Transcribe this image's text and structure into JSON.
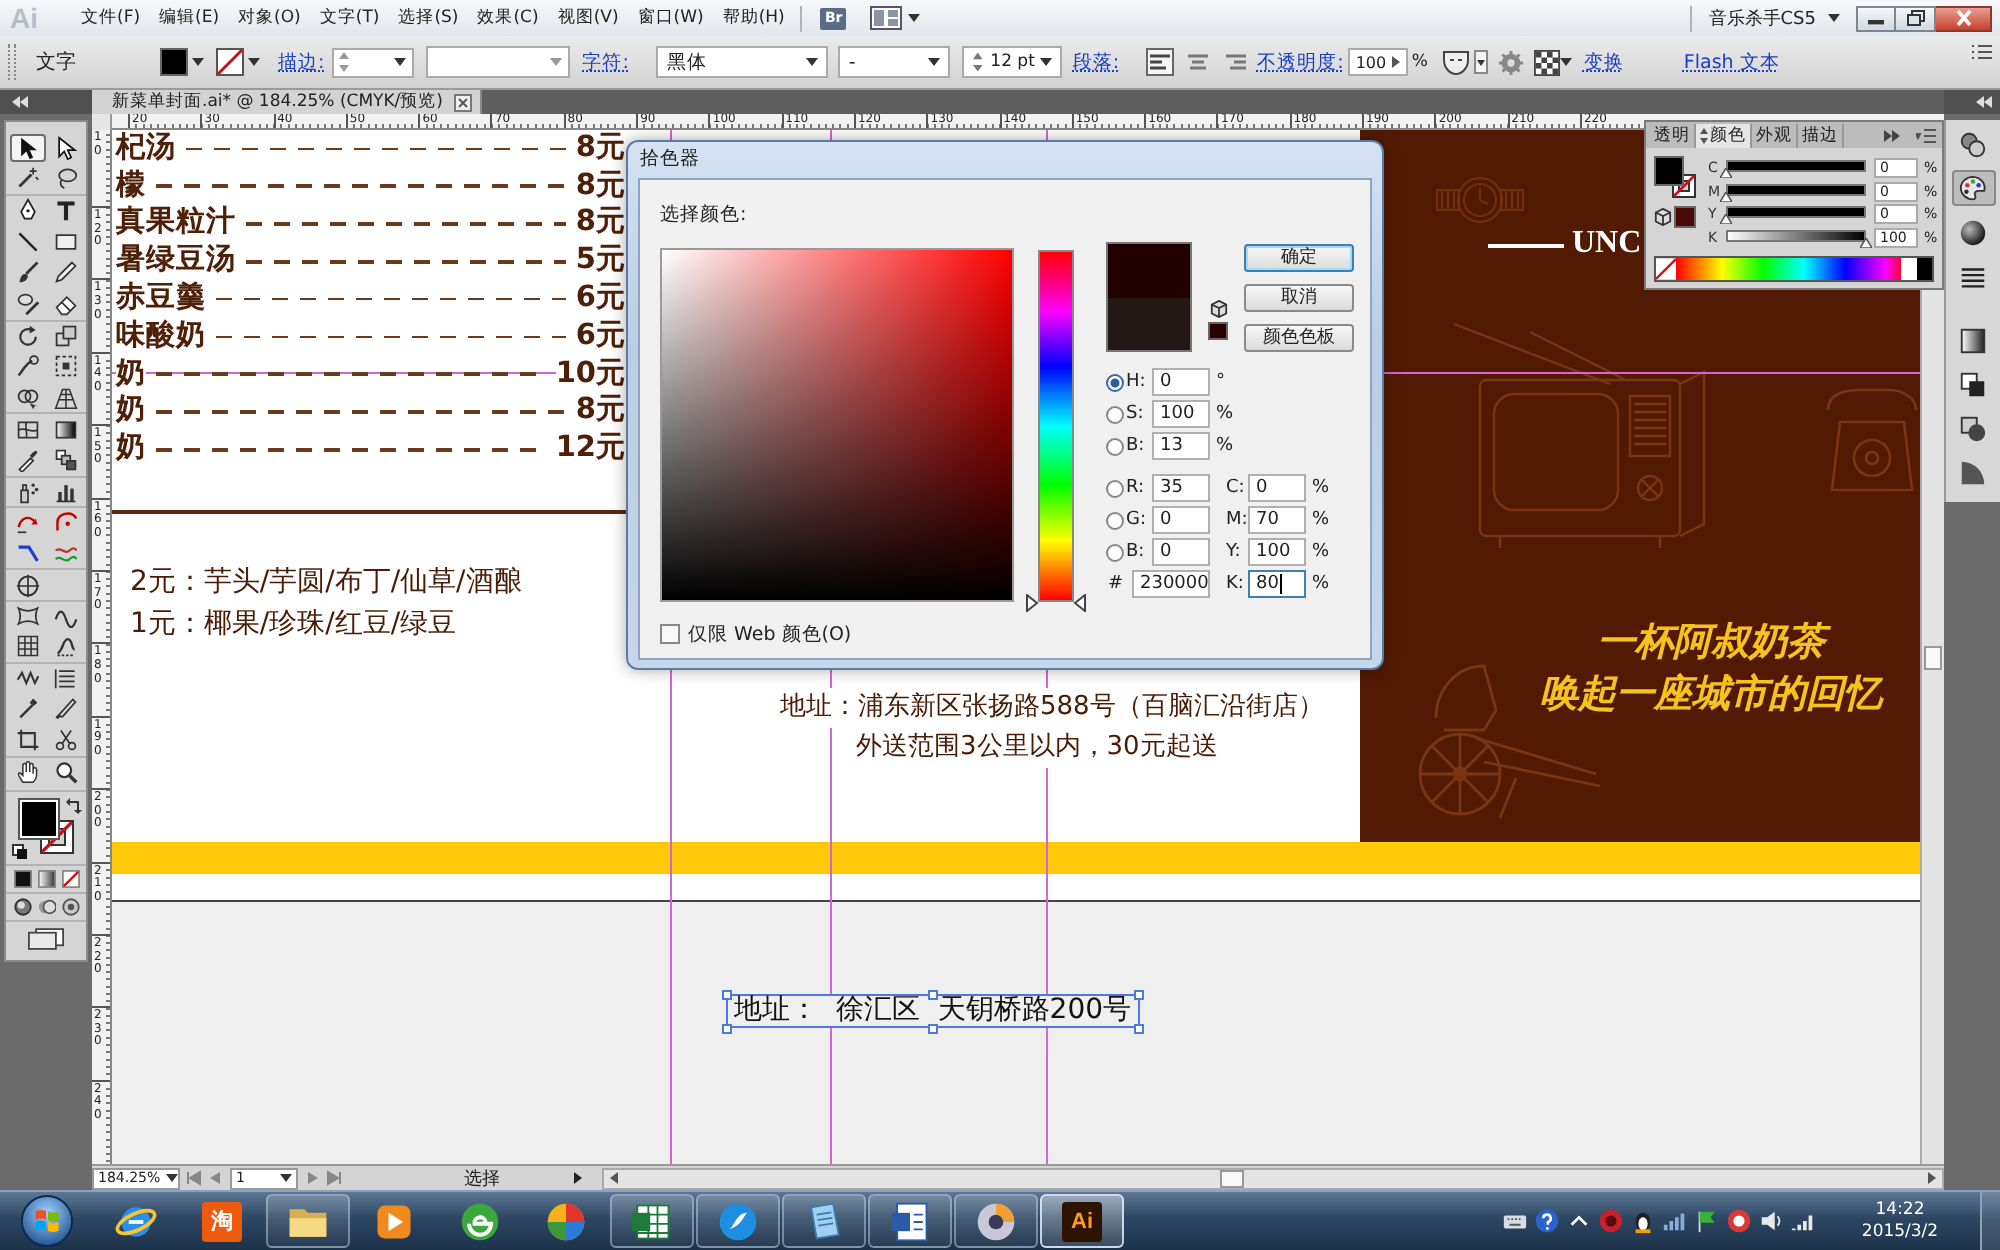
{
  "menu_bar": {
    "logo": "Ai",
    "items": [
      "文件(F)",
      "编辑(E)",
      "对象(O)",
      "文字(T)",
      "选择(S)",
      "效果(C)",
      "视图(V)",
      "窗口(W)",
      "帮助(H)"
    ],
    "bridge": "Br",
    "workspace": "音乐杀手CS5"
  },
  "control_bar": {
    "tool": "文字",
    "stroke_label": "描边:",
    "character_label": "字符:",
    "font": "黑体",
    "font_style": "-",
    "font_size": "12 pt",
    "paragraph_label": "段落:",
    "alignment": [
      {
        "selected": true
      },
      {
        "selected": false
      },
      {
        "selected": false
      }
    ],
    "opacity_label": "不透明度:",
    "opacity": "100",
    "opacity_unit": "%",
    "transform_link": "变换",
    "flash_text_link": "Flash 文本"
  },
  "document_tab": {
    "title": "新菜单封面.ai* @ 184.25% (CMYK/预览)"
  },
  "toolbox": {
    "tools": [
      {
        "selected": true
      },
      {
        "selected": false
      },
      {
        "selected": false
      },
      {
        "selected": false
      },
      {
        "selected": false
      },
      {
        "selected": false
      },
      {
        "selected": false
      },
      {
        "selected": false
      },
      {
        "selected": false
      },
      {
        "selected": false
      },
      {
        "selected": false
      },
      {
        "selected": false
      },
      {
        "selected": false
      },
      {
        "selected": false
      },
      {
        "selected": false
      },
      {
        "selected": false
      },
      {
        "selected": false
      },
      {
        "selected": false
      },
      {
        "selected": false
      },
      {
        "selected": false
      },
      {
        "selected": false
      },
      {
        "selected": false
      },
      {
        "selected": false
      },
      {
        "selected": false
      },
      {
        "selected": false
      },
      {
        "selected": false
      },
      {
        "selected": false
      },
      {
        "selected": false
      },
      {
        "selected": false
      },
      {
        "selected": false
      },
      {
        "selected": false
      },
      {
        "selected": false
      },
      {
        "selected": false
      },
      {
        "selected": false
      },
      {
        "selected": false
      },
      {
        "selected": false
      },
      {
        "selected": false
      },
      {
        "selected": false
      },
      {
        "selected": false
      },
      {
        "selected": false
      },
      {
        "selected": false
      }
    ]
  },
  "rulers": {
    "horizontal": [
      "20",
      "30",
      "40",
      "50",
      "60",
      "70",
      "80",
      "90",
      "100",
      "110",
      "120",
      "130",
      "140",
      "150",
      "160",
      "170",
      "180",
      "190",
      "200",
      "210",
      "220"
    ],
    "vertical": [
      "10",
      "120",
      "130",
      "140",
      "150",
      "160",
      "170",
      "180",
      "190",
      "200",
      "210",
      "220",
      "230",
      "240"
    ]
  },
  "artboard": {
    "menu_items": [
      {
        "name": "杞汤",
        "price": "8元"
      },
      {
        "name": "檬",
        "price": "8元"
      },
      {
        "name": "真果粒汁",
        "price": "8元"
      },
      {
        "name": "暑绿豆汤",
        "price": "5元"
      },
      {
        "name": "赤豆羹",
        "price": "6元"
      },
      {
        "name": "味酸奶",
        "price": "6元"
      },
      {
        "name": "奶",
        "price": "10元"
      },
      {
        "name": "奶",
        "price": "8元"
      },
      {
        "name": "奶",
        "price": "12元"
      }
    ],
    "toppings": [
      "2元：芋头/芋圆/布丁/仙草/酒酿",
      "1元：椰果/珍珠/红豆/绿豆"
    ],
    "address": [
      "地址：浦东新区张扬路588号（百脑汇沿街店）",
      "外送范围3公里以内，30元起送"
    ],
    "poster": {
      "subtitle": "UNC",
      "slogan": [
        "一杯阿叔奶茶",
        "唤起一座城市的回忆"
      ]
    },
    "selected_text": "地址：  徐汇区  天钥桥路200号"
  },
  "color_panel": {
    "tabs": [
      {
        "label": "透明",
        "selected": false
      },
      {
        "label": "颜色",
        "selected": true
      },
      {
        "label": "外观",
        "selected": false
      },
      {
        "label": "描边",
        "selected": false
      }
    ],
    "channels": [
      {
        "name": "C",
        "level": 0,
        "value": "0",
        "unit": "%"
      },
      {
        "name": "M",
        "level": 0,
        "value": "0",
        "unit": "%"
      },
      {
        "name": "Y",
        "level": 0,
        "value": "0",
        "unit": "%"
      },
      {
        "name": "K",
        "level": 1,
        "value": "100",
        "unit": "%"
      }
    ]
  },
  "dock": {
    "buttons": [
      {
        "selected": false
      },
      {
        "selected": true
      },
      {
        "selected": false
      },
      {
        "selected": false
      },
      {
        "selected": false
      },
      {
        "selected": false
      },
      {
        "selected": false
      },
      {
        "selected": false
      }
    ]
  },
  "color_picker": {
    "title": "拾色器",
    "prompt": "选择颜色:",
    "buttons": [
      {
        "label": "确定",
        "default": true
      },
      {
        "label": "取消",
        "default": false
      },
      {
        "label": "颜色色板",
        "default": false
      }
    ],
    "hue_slider": {
      "level": 0
    },
    "hsb": [
      {
        "label": "H:",
        "value": "0",
        "unit": "°",
        "selected": true
      },
      {
        "label": "S:",
        "value": "100",
        "unit": "%",
        "selected": false
      },
      {
        "label": "B:",
        "value": "13",
        "unit": "%",
        "selected": false
      }
    ],
    "rgb": [
      {
        "label": "R:",
        "value": "35",
        "selected": false
      },
      {
        "label": "G:",
        "value": "0",
        "selected": false
      },
      {
        "label": "B:",
        "value": "0",
        "selected": false
      }
    ],
    "hex": {
      "label": "#",
      "value": "230000"
    },
    "cmyk": [
      {
        "label": "C:",
        "value": "0",
        "unit": "%",
        "focused": false
      },
      {
        "label": "M:",
        "value": "70",
        "unit": "%",
        "focused": false
      },
      {
        "label": "Y:",
        "value": "100",
        "unit": "%",
        "focused": false
      },
      {
        "label": "K:",
        "value": "80",
        "unit": "%",
        "focused": true
      }
    ],
    "web_only": {
      "label": "仅限 Web 颜色(O)",
      "checked": false
    }
  },
  "status_bar": {
    "zoom": "184.25%",
    "page": "1",
    "status": "选择"
  },
  "taskbar": {
    "items": [
      {
        "kind": "icon",
        "running": false,
        "selected": false
      },
      {
        "kind": "tile",
        "label": "淘",
        "color": "#ee5a0e",
        "running": false,
        "selected": false
      },
      {
        "kind": "icon",
        "running": true,
        "selected": false
      },
      {
        "kind": "icon",
        "running": false,
        "selected": false
      },
      {
        "kind": "icon",
        "running": false,
        "selected": false
      },
      {
        "kind": "icon",
        "running": false,
        "selected": false
      },
      {
        "kind": "icon",
        "running": true,
        "selected": false
      },
      {
        "kind": "icon",
        "running": true,
        "selected": false
      },
      {
        "kind": "icon",
        "running": true,
        "selected": false
      },
      {
        "kind": "icon",
        "running": true,
        "selected": false
      },
      {
        "kind": "icon",
        "running": true,
        "selected": false
      },
      {
        "kind": "tile",
        "label": "Ai",
        "color": "#2e1400",
        "running": true,
        "selected": true
      }
    ],
    "clock": {
      "time": "14:22",
      "date": "2015/3/2"
    }
  }
}
